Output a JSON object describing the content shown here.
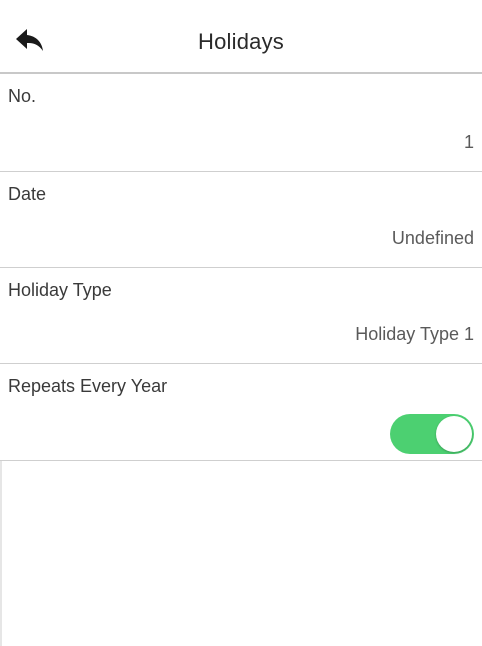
{
  "header": {
    "title": "Holidays",
    "back_icon": "back-arrow-icon"
  },
  "fields": [
    {
      "label": "No.",
      "value": "1"
    },
    {
      "label": "Date",
      "value": "Undefined"
    },
    {
      "label": "Holiday Type",
      "value": "Holiday Type 1"
    },
    {
      "label": "Repeats Every Year",
      "toggle_on": true
    }
  ],
  "colors": {
    "toggle_on": "#4cd071",
    "divider": "#cfcfcf"
  }
}
